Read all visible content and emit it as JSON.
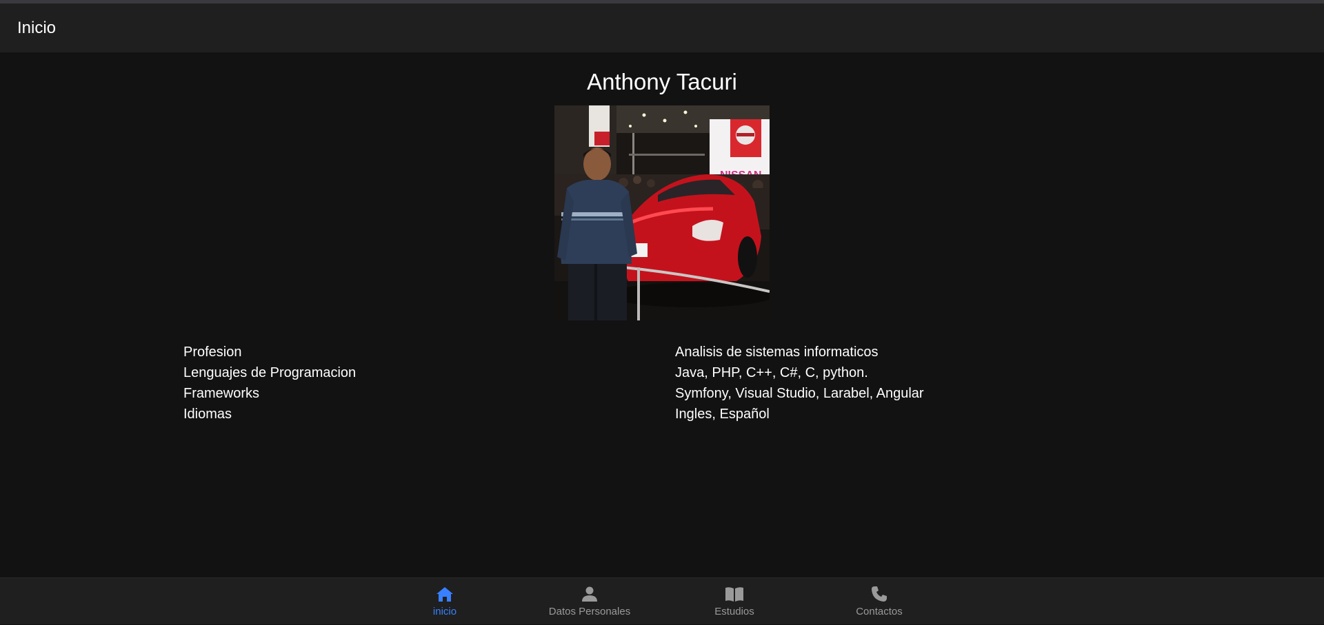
{
  "header": {
    "title": "Inicio"
  },
  "profile": {
    "name": "Anthony Tacuri",
    "photo_sign_text": "NISSAN",
    "details": [
      {
        "label": "Profesion",
        "value": "Analisis de sistemas informaticos"
      },
      {
        "label": "Lenguajes de Programacion",
        "value": "Java, PHP, C++, C#, C, python."
      },
      {
        "label": "Frameworks",
        "value": "Symfony, Visual Studio, Larabel, Angular"
      },
      {
        "label": "Idiomas",
        "value": "Ingles, Español"
      }
    ]
  },
  "tabs": [
    {
      "label": "inicio",
      "icon": "home-icon",
      "active": true
    },
    {
      "label": "Datos Personales",
      "icon": "person-icon",
      "active": false
    },
    {
      "label": "Estudios",
      "icon": "book-icon",
      "active": false
    },
    {
      "label": "Contactos",
      "icon": "phone-icon",
      "active": false
    }
  ],
  "colors": {
    "background": "#121212",
    "toolbar": "#1f1f1f",
    "active_tab": "#3880ff",
    "inactive_tab": "#9a9a9a"
  }
}
